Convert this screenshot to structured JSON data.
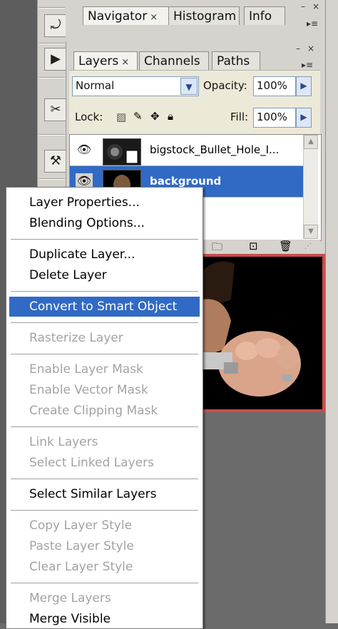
{
  "nav_panel": {
    "tabs": [
      {
        "label": "Navigator",
        "close": "×"
      },
      {
        "label": "Histogram"
      },
      {
        "label": "Info"
      }
    ],
    "controls": {
      "minimize": "–",
      "close": "×"
    }
  },
  "layers_panel": {
    "tabs": [
      {
        "label": "Layers",
        "close": "×"
      },
      {
        "label": "Channels"
      },
      {
        "label": "Paths"
      }
    ],
    "controls": {
      "minimize": "–",
      "close": "×"
    },
    "blend_mode": "Normal",
    "opacity_label": "Opacity:",
    "opacity_value": "100%",
    "lock_label": "Lock:",
    "fill_label": "Fill:",
    "fill_value": "100%",
    "layers": [
      {
        "name": "bigstock_Bullet_Hole_I...",
        "visible": true,
        "selected": false
      },
      {
        "name": "background",
        "visible": true,
        "selected": true
      }
    ]
  },
  "context_menu": {
    "items": [
      {
        "label": "Layer Properties...",
        "enabled": true
      },
      {
        "label": "Blending Options...",
        "enabled": true
      },
      {
        "label": "Duplicate Layer...",
        "enabled": true
      },
      {
        "label": "Delete Layer",
        "enabled": true
      },
      {
        "label": "Convert to Smart Object",
        "enabled": true,
        "highlighted": true
      },
      {
        "label": "Rasterize Layer",
        "enabled": false
      },
      {
        "label": "Enable Layer Mask",
        "enabled": false
      },
      {
        "label": "Enable Vector Mask",
        "enabled": false
      },
      {
        "label": "Create Clipping Mask",
        "enabled": false
      },
      {
        "label": "Link Layers",
        "enabled": false
      },
      {
        "label": "Select Linked Layers",
        "enabled": false
      },
      {
        "label": "Select Similar Layers",
        "enabled": true
      },
      {
        "label": "Copy Layer Style",
        "enabled": false
      },
      {
        "label": "Paste Layer Style",
        "enabled": false
      },
      {
        "label": "Clear Layer Style",
        "enabled": false
      },
      {
        "label": "Merge Layers",
        "enabled": false
      },
      {
        "label": "Merge Visible",
        "enabled": true
      }
    ]
  },
  "colors": {
    "highlight": "#316ac5",
    "canvas_border": "#c94c4c",
    "panel_bg": "#d6d3ce"
  }
}
